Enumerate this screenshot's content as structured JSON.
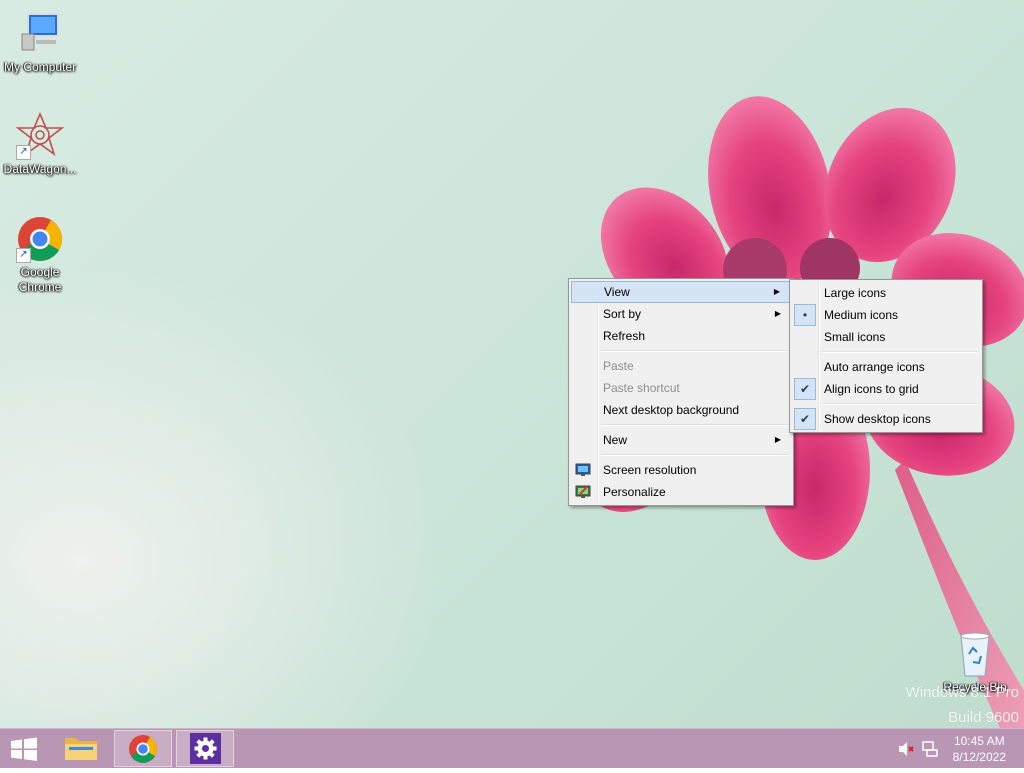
{
  "desktop": {
    "icons": [
      {
        "label": "My Computer",
        "icon": "computer-icon"
      },
      {
        "label": "DataWagon...",
        "icon": "datawagon-icon"
      },
      {
        "label_line1": "Google",
        "label_line2": "Chrome",
        "icon": "chrome-icon"
      },
      {
        "label": "Recycle Bin",
        "icon": "recycle-bin-icon"
      }
    ],
    "watermark": {
      "line1": "Windows 8.1 Pro",
      "line2": "Build 9600"
    }
  },
  "context_menu": {
    "items": [
      {
        "label": "View",
        "submenu": true,
        "highlighted": true
      },
      {
        "label": "Sort by",
        "submenu": true
      },
      {
        "label": "Refresh"
      },
      {
        "label": "Paste",
        "disabled": true
      },
      {
        "label": "Paste shortcut",
        "disabled": true
      },
      {
        "label": "Next desktop background"
      },
      {
        "label": "New",
        "submenu": true
      },
      {
        "label": "Screen resolution",
        "icon": "screen-resolution-icon"
      },
      {
        "label": "Personalize",
        "icon": "personalize-icon"
      }
    ]
  },
  "view_submenu": {
    "items": [
      {
        "label": "Large icons"
      },
      {
        "label": "Medium icons",
        "selected": true,
        "mark": "•"
      },
      {
        "label": "Small icons"
      },
      {
        "label": "Auto arrange icons"
      },
      {
        "label": "Align icons to grid",
        "checked": true,
        "mark": "✔"
      },
      {
        "label": "Show desktop icons",
        "checked": true,
        "mark": "✔"
      }
    ]
  },
  "taskbar": {
    "start_icon": "windows-start-icon",
    "pinned": [
      "file-explorer-icon",
      "chrome-icon",
      "settings-gear-icon"
    ],
    "tray": [
      "speaker-muted-icon",
      "network-icon"
    ],
    "time": "10:45 AM",
    "date": "8/12/2022"
  },
  "colors": {
    "taskbar": "#b996b4",
    "menu_bg": "#f0f0f0",
    "menu_highlight": "#d5e4f4",
    "petal": "#e8457f"
  }
}
